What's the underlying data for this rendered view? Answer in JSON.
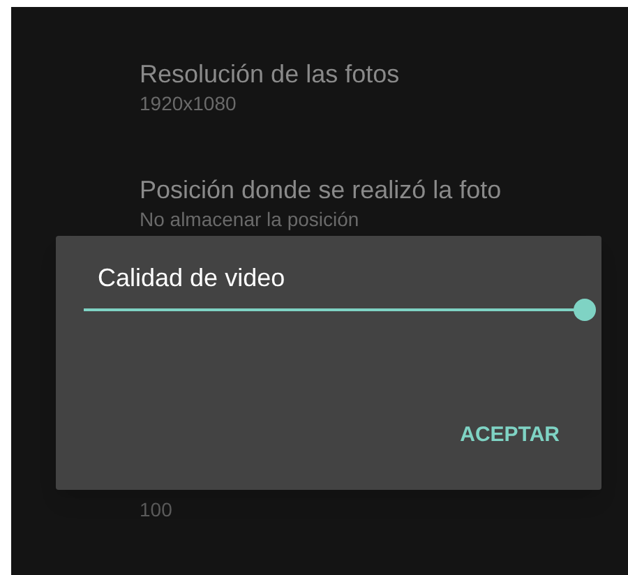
{
  "settings": [
    {
      "title": "Resolución de las fotos",
      "value": "1920x1080"
    },
    {
      "title": "Posición donde se realizó la foto",
      "value": "No almacenar la posición"
    }
  ],
  "hidden_setting": {
    "value": "100"
  },
  "dialog": {
    "title": "Calidad de video",
    "slider": {
      "level": 1
    },
    "button": "ACEPTAR"
  }
}
